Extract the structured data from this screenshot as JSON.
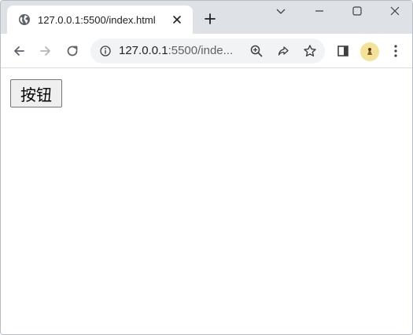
{
  "tab": {
    "title": "127.0.0.1:5500/index.html",
    "favicon": "globe-icon",
    "close": "close-icon"
  },
  "window_controls": [
    "chevron-down-icon",
    "minimize-icon",
    "maximize-icon",
    "close-icon"
  ],
  "toolbar": {
    "back": "back-arrow-icon",
    "forward": "forward-arrow-icon",
    "reload": "reload-icon",
    "url_host": "127.0.0.1",
    "url_rest": ":5500/inde...",
    "omnibox_icons": [
      "zoom-icon",
      "share-icon",
      "star-icon"
    ],
    "side_panel": "side-panel-icon",
    "profile": "profile-avatar",
    "menu": "kebab-menu-icon"
  },
  "page": {
    "button_label": "按钮"
  },
  "colors": {
    "titlebar": "#dee1e6",
    "tab": "#ffffff",
    "omnibox": "#f1f3f4",
    "icon": "#5f6368",
    "button_bg": "#efefef",
    "button_border": "#767676"
  }
}
